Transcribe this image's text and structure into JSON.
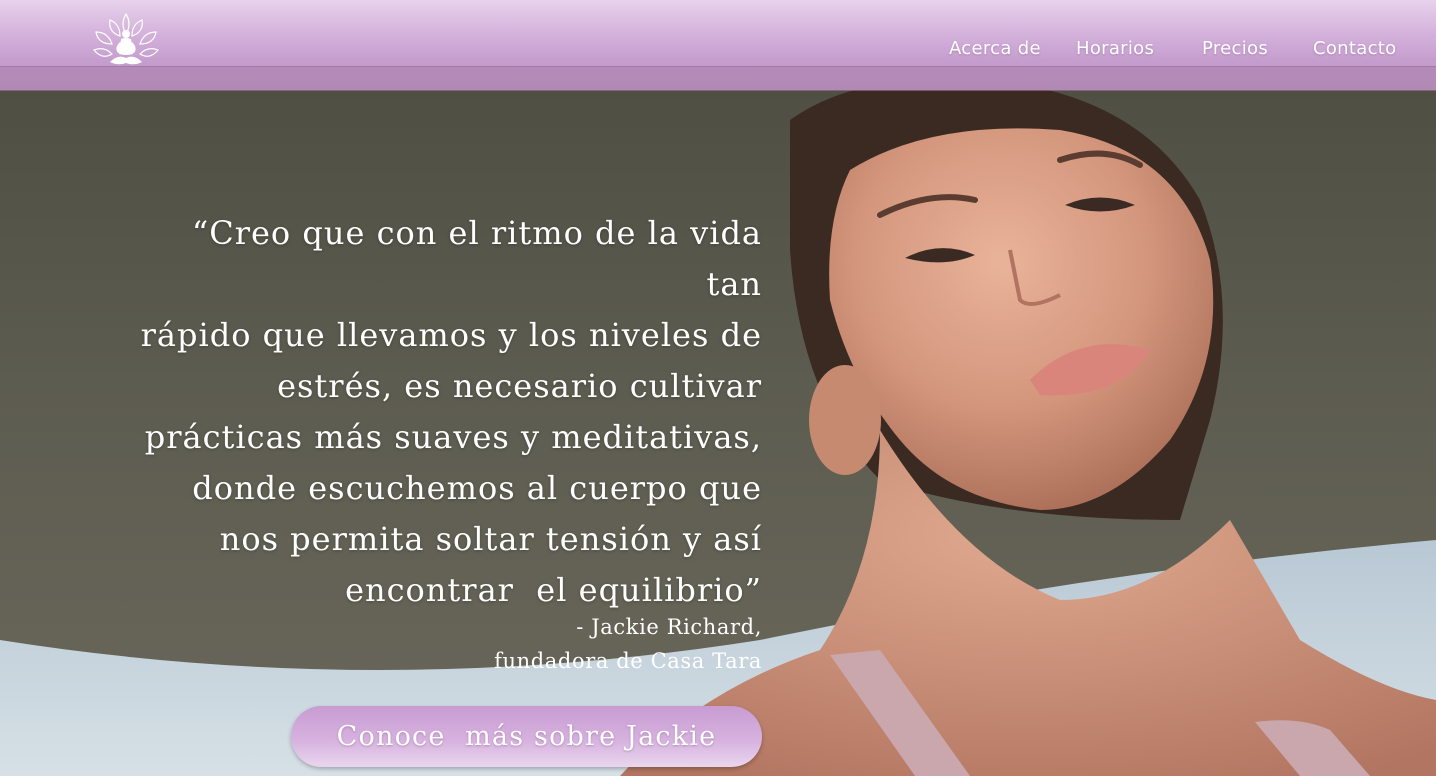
{
  "header": {
    "logo_icon": "meditation-lotus-icon",
    "nav": [
      {
        "label": "Acerca de"
      },
      {
        "label": "Horarios"
      },
      {
        "label": "Precios"
      },
      {
        "label": "Contacto"
      }
    ]
  },
  "hero": {
    "quote_lines": [
      "“Creo que con el ritmo de la vida tan",
      "rápido que llevamos y los niveles de",
      "estrés, es necesario cultivar",
      "prácticas más suaves y meditativas,",
      "donde escuchemos al cuerpo que",
      "nos permita soltar tensión y así",
      "encontrar  el equilibrio”"
    ],
    "attribution_name": "- Jackie Richard,",
    "attribution_role": "fundadora de Casa Tara",
    "cta_label": "Conoce  más sobre Jackie"
  },
  "colors": {
    "header_top": "#e7d2ec",
    "header_bottom": "#bd97c4",
    "cta": "#d6b1de",
    "text": "#ffffff"
  }
}
